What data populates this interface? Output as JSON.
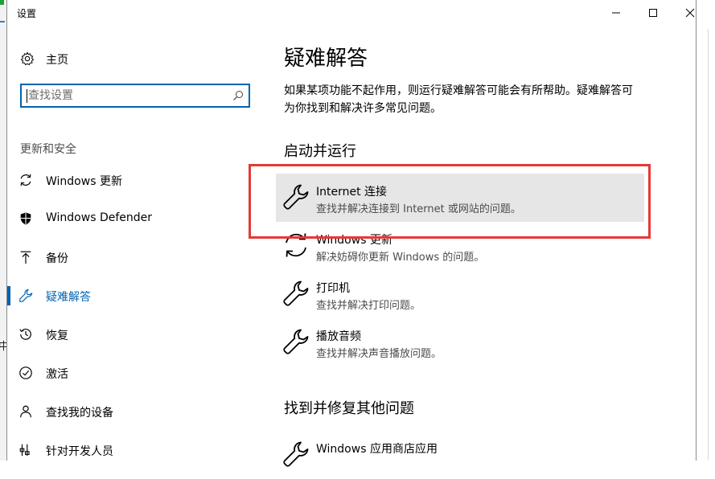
{
  "background": {
    "side_char": "中"
  },
  "window": {
    "title": "设置",
    "controls": {
      "minimize": "minimize-icon",
      "maximize": "maximize-icon",
      "close": "close-icon"
    }
  },
  "sidebar": {
    "home_label": "主页",
    "search_placeholder": "查找设置",
    "section_label": "更新和安全",
    "items": [
      {
        "label": "Windows 更新",
        "icon": "sync-icon"
      },
      {
        "label": "Windows Defender",
        "icon": "shield-icon"
      },
      {
        "label": "备份",
        "icon": "backup-arrow-icon"
      },
      {
        "label": "疑难解答",
        "icon": "wrench-icon",
        "active": true
      },
      {
        "label": "恢复",
        "icon": "history-icon"
      },
      {
        "label": "激活",
        "icon": "check-circle-icon"
      },
      {
        "label": "查找我的设备",
        "icon": "person-locate-icon"
      },
      {
        "label": "针对开发人员",
        "icon": "developer-icon"
      }
    ]
  },
  "main": {
    "title": "疑难解答",
    "description": "如果某项功能不起作用，则运行疑难解答可能会有所帮助。疑难解答可为你找到和解决许多常见问题。",
    "section1": "启动并运行",
    "troubleshooters": [
      {
        "name": "Internet 连接",
        "desc": "查找并解决连接到 Internet 或网站的问题。",
        "icon": "wrench-icon"
      },
      {
        "name": "Windows 更新",
        "desc": "解决妨碍你更新 Windows 的问题。",
        "icon": "sync-icon"
      },
      {
        "name": "打印机",
        "desc": "查找并解决打印问题。",
        "icon": "wrench-icon"
      },
      {
        "name": "播放音频",
        "desc": "查找并解决声音播放问题。",
        "icon": "wrench-icon"
      }
    ],
    "section2": "找到并修复其他问题",
    "other": [
      {
        "name": "Windows 应用商店应用",
        "icon": "wrench-icon"
      }
    ]
  },
  "colors": {
    "accent": "#0063b1",
    "highlight": "#e53935",
    "hover_bg": "#e6e6e6"
  }
}
